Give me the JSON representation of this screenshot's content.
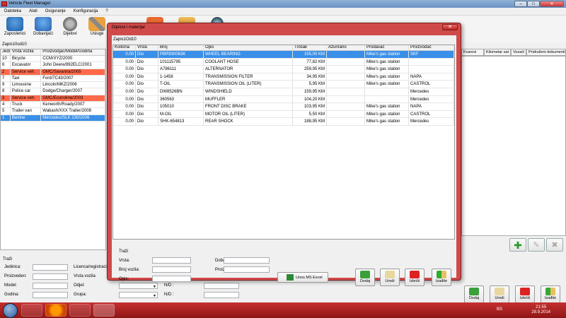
{
  "app": {
    "title": "Vehicle Fleet Manager"
  },
  "menu": [
    "Datoteka",
    "Alati",
    "Osiguranje",
    "Konfiguracija",
    "?"
  ],
  "toolbar": {
    "zaposlenici": "Zaposlenici",
    "dobavljaci": "Dobavljači",
    "dijelovi": "Dijelovi",
    "usluge": "Usluge"
  },
  "left": {
    "record_counter": "Zapis10od10",
    "columns": [
      "Jedinic",
      "Vrsta vozila",
      "Proizvodjac/Model/Godina"
    ],
    "rows": [
      {
        "id": "10",
        "type": "Bicycle",
        "model": "CCM/XYZ/2000",
        "state": ""
      },
      {
        "id": "6",
        "type": "Excavator",
        "model": "John Deere/892ELC/2001",
        "state": ""
      },
      {
        "id": "2",
        "type": "Service veh.",
        "model": "GMC/Savanna/2005",
        "state": "red"
      },
      {
        "id": "7",
        "type": "Taxi",
        "model": "Ford/7C43/2007",
        "state": ""
      },
      {
        "id": "9",
        "type": "Limousine",
        "model": "Lincoln/MKZ/2006",
        "state": ""
      },
      {
        "id": "8",
        "type": "Police car",
        "model": "Dodge/Charger/2007",
        "state": ""
      },
      {
        "id": "3",
        "type": "Service veh.",
        "model": "GMC/Econoline/2003",
        "state": "red"
      },
      {
        "id": "4",
        "type": "Truck",
        "model": "Kenworth/Roady/2007",
        "state": ""
      },
      {
        "id": "5",
        "type": "Trailer van",
        "model": "Wabash/XXX Trailer/2008",
        "state": ""
      },
      {
        "id": "1",
        "type": "Berline",
        "model": "Mercedes/SLK 230/2006",
        "state": "blue"
      }
    ]
  },
  "search_main": {
    "title": "Traži",
    "jedinica": "Jedinica:",
    "licenca": "Licenca/registracija:",
    "proizveden": "Proizveden:",
    "vrsta_vozila": "Vrsta vozila",
    "model": "Model:",
    "odjel": "Odjel:",
    "godina": "Godina:",
    "grupa": "Grupa:",
    "nd1": "N/D :",
    "nd2": "N/D :"
  },
  "right": {
    "tabs": [
      "Kvarovi",
      "Kilometar sat",
      "Vozači",
      "Pridruženi dokumenti"
    ],
    "buttons": {
      "dodaj": "Dodaj",
      "uredi": "Uredi",
      "izbrisi": "Izbriši",
      "izadi": "Izađite"
    }
  },
  "dialog": {
    "title": "Dijelovi i materijal",
    "record_counter": "Zapis1Od10",
    "columns": [
      "Količina",
      "Vrsta",
      "Broj",
      "Opis",
      "Trošak",
      "Ažurirano",
      "Prodavač",
      "Proizvođač"
    ],
    "rows": [
      {
        "qty": "0.00",
        "vrsta": "Dio",
        "broj": "PBR930063K",
        "opis": "WHEEL BEARING",
        "trosak": "155,00 KM",
        "azurirano": "",
        "prodavac": "Mike's gas station",
        "proizvodac": "SKF"
      },
      {
        "qty": "0.00",
        "vrsta": "Dio",
        "broj": "101115795",
        "opis": "COOLANT HOSE",
        "trosak": "77,82 KM",
        "azurirano": "",
        "prodavac": "Mike's gas station",
        "proizvodac": ""
      },
      {
        "qty": "0.00",
        "vrsta": "Dio",
        "broj": "A786111",
        "opis": "ALTERNATOR",
        "trosak": "259,95 KM",
        "azurirano": "",
        "prodavac": "Mike's gas station",
        "proizvodac": ""
      },
      {
        "qty": "0.00",
        "vrsta": "Dio",
        "broj": "1-1458",
        "opis": "TRANSMISSION FILTER",
        "trosak": "34,95 KM",
        "azurirano": "",
        "prodavac": "Mike's gas station",
        "proizvodac": "NAPA"
      },
      {
        "qty": "0.00",
        "vrsta": "Dio",
        "broj": "T-OIL",
        "opis": "TRANSMISSION OIL (LITER)",
        "trosak": "5,95 KM",
        "azurirano": "",
        "prodavac": "Mike's gas station",
        "proizvodac": "CASTROL"
      },
      {
        "qty": "0.00",
        "vrsta": "Dio",
        "broj": "DW8526BN",
        "opis": "WINDSHIELD",
        "trosak": "159,95 KM",
        "azurirano": "",
        "prodavac": "",
        "proizvodac": "Mercedes"
      },
      {
        "qty": "0.00",
        "vrsta": "Dio",
        "broj": "360563",
        "opis": "MUFFLER",
        "trosak": "104,20 KM",
        "azurirano": "",
        "prodavac": "",
        "proizvodac": "Mercedes"
      },
      {
        "qty": "0.00",
        "vrsta": "Dio",
        "broj": "105010",
        "opis": "FRONT DISC BRAKE",
        "trosak": "103,95 KM",
        "azurirano": "",
        "prodavac": "Mike's gas station",
        "proizvodac": "NAPA"
      },
      {
        "qty": "0.00",
        "vrsta": "Dio",
        "broj": "M-OIL",
        "opis": "MOTOR OIL (LITER)",
        "trosak": "5,50 KM",
        "azurirano": "",
        "prodavac": "Mike's gas station",
        "proizvodac": "CASTROL"
      },
      {
        "qty": "0.00",
        "vrsta": "Dio",
        "broj": "SHK-654813",
        "opis": "REAR SHOCK",
        "trosak": "188,95 KM",
        "azurirano": "",
        "prodavac": "Mike's gas station",
        "proizvodac": "Mercedes"
      }
    ],
    "search": {
      "title": "Traži",
      "vrsta": "Vrsta:",
      "broj_vozila": "Broj vozila:",
      "opis": "Opis:",
      "dobavljac": "Dobavljač:",
      "proizvodac": "Proizvođač:"
    },
    "buttons": {
      "excel": "Unos MS Excel",
      "dodaj": "Dodaj",
      "uredi": "Uredi",
      "izbrisi": "Izbriši",
      "izadi": "Izađite"
    }
  },
  "taskbar": {
    "lang": "BS",
    "time": "21:55",
    "date": "28.9.2014"
  }
}
